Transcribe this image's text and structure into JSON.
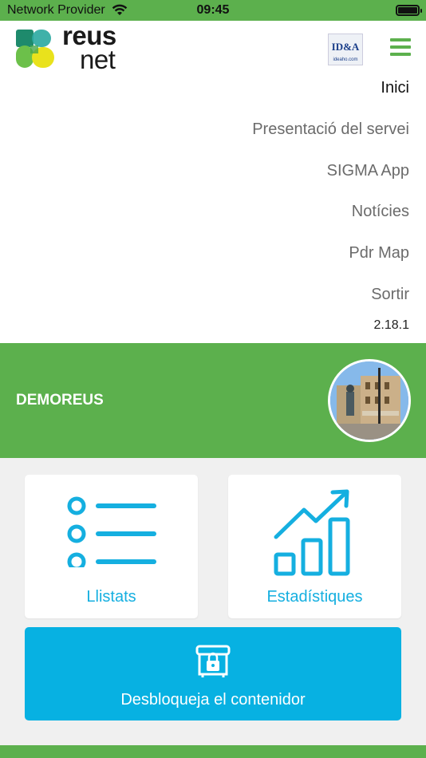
{
  "status_bar": {
    "provider": "Network Provider",
    "time": "09:45"
  },
  "header": {
    "logo": {
      "line1": "reus",
      "line2": "net"
    },
    "partner_logo": {
      "text": "ID&A",
      "subtext": "ideaho.com"
    }
  },
  "menu": {
    "items": [
      {
        "label": "Inici",
        "active": true
      },
      {
        "label": "Presentació del servei",
        "active": false
      },
      {
        "label": "SIGMA App",
        "active": false
      },
      {
        "label": "Notícies",
        "active": false
      },
      {
        "label": "Pdr Map",
        "active": false
      },
      {
        "label": "Sortir",
        "active": false
      }
    ],
    "version": "2.18.1"
  },
  "user": {
    "name": "DEMOREUS"
  },
  "actions": {
    "lists_label": "Llistats",
    "stats_label": "Estadístiques",
    "unlock_label": "Desbloqueja el contenidor"
  },
  "colors": {
    "brand_green": "#5cb04d",
    "accent_blue": "#15afe0",
    "button_blue": "#07b1e2"
  },
  "icons": [
    "wifi-icon",
    "battery-icon",
    "hamburger-menu-icon",
    "list-icon",
    "chart-icon",
    "container-lock-icon"
  ]
}
